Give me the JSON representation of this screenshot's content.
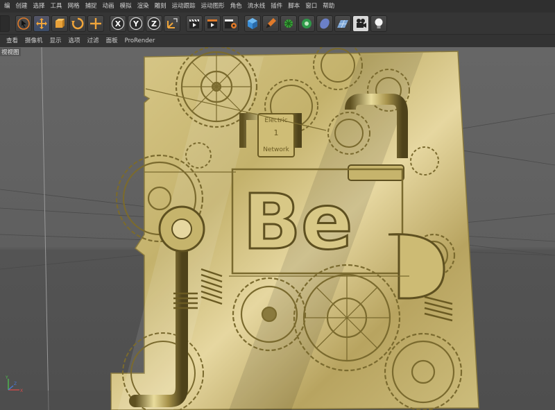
{
  "menubar": {
    "items": [
      "编",
      "创建",
      "选择",
      "工具",
      "网格",
      "捕捉",
      "动画",
      "模拟",
      "渲染",
      "雕刻",
      "运动跟踪",
      "运动图形",
      "角色",
      "流水线",
      "插件",
      "脚本",
      "窗口",
      "帮助"
    ]
  },
  "toolbar": {
    "xyz": [
      "X",
      "Y",
      "Z"
    ]
  },
  "viewbar": {
    "items": [
      "查看",
      "摄像机",
      "显示",
      "选项",
      "过滤",
      "面板",
      "ProRender"
    ]
  },
  "viewport": {
    "label": "视视图",
    "sign_lines": [
      "Electric",
      "1",
      "Network"
    ],
    "logo_text": "Be",
    "colors": {
      "gold": "#c9b97a",
      "gold_dark": "#8a7a3e",
      "gold_light": "#efe3a8",
      "bg_top": "#666666",
      "bg_bottom": "#4e4e4e"
    }
  },
  "axis": {
    "x": "X",
    "y": "Y",
    "z": "Z"
  }
}
